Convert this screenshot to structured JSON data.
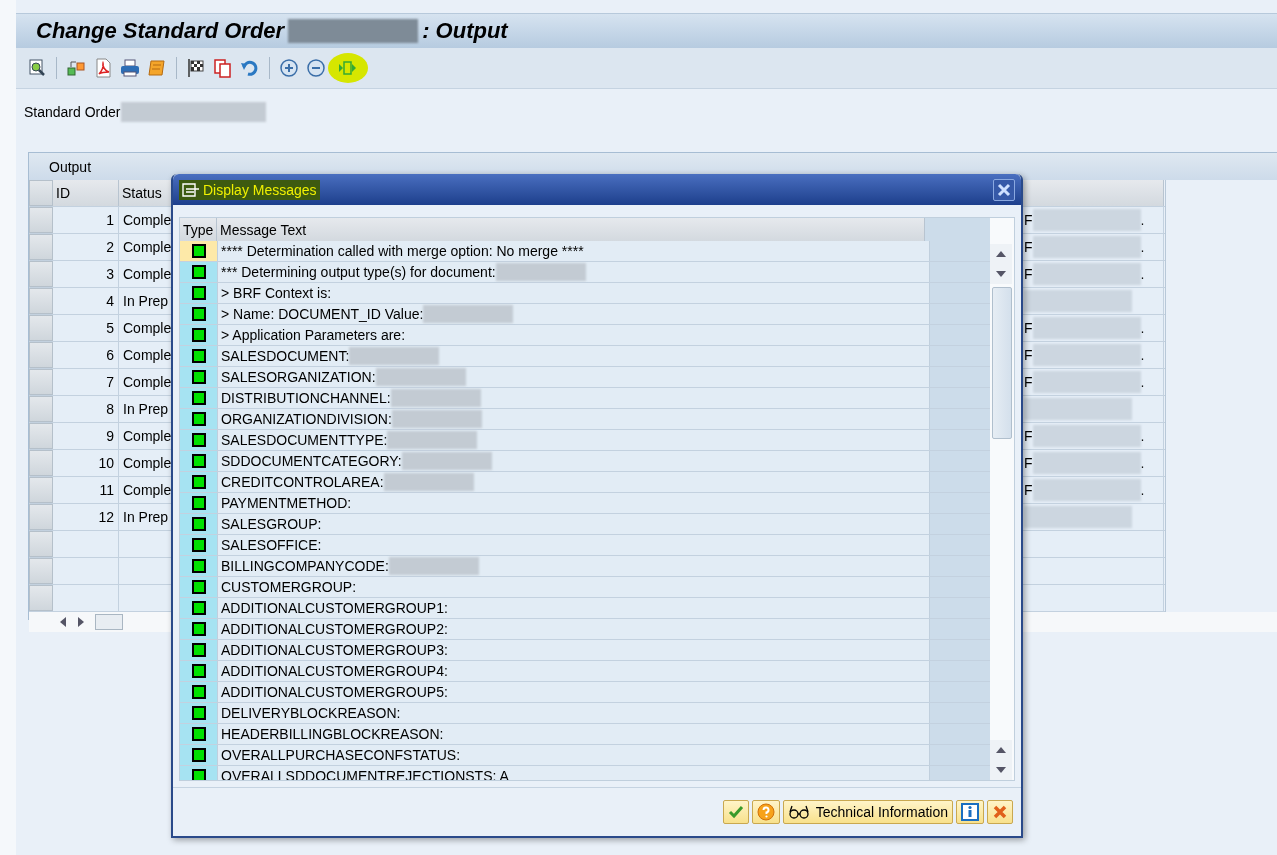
{
  "window": {
    "title_before": "Change Standard Order",
    "title_after": ": Output",
    "title_redacted": true
  },
  "toolbar": {
    "items": [
      {
        "kind": "display"
      },
      {
        "kind": "sep"
      },
      {
        "kind": "objects"
      },
      {
        "kind": "pdf"
      },
      {
        "kind": "print"
      },
      {
        "kind": "scroll"
      },
      {
        "kind": "sep"
      },
      {
        "kind": "flag"
      },
      {
        "kind": "copy"
      },
      {
        "kind": "undo"
      },
      {
        "kind": "sep"
      },
      {
        "kind": "plus"
      },
      {
        "kind": "minus"
      },
      {
        "kind": "process",
        "highlighted": true
      }
    ]
  },
  "header_field": {
    "label": "Standard Order",
    "redacted": true
  },
  "output": {
    "title": "Output",
    "columns": [
      "ID",
      "Status"
    ],
    "rows": [
      {
        "id": "1",
        "status": "Comple",
        "column_3": "F",
        "column_3_end": "."
      },
      {
        "id": "2",
        "status": "Comple",
        "column_3": "F",
        "column_3_end": "."
      },
      {
        "id": "3",
        "status": "Comple",
        "column_3": "F",
        "column_3_end": "."
      },
      {
        "id": "4",
        "status": "In Prep"
      },
      {
        "id": "5",
        "status": "Comple",
        "column_3": "F",
        "column_3_end": "."
      },
      {
        "id": "6",
        "status": "Comple",
        "column_3": "F",
        "column_3_end": "."
      },
      {
        "id": "7",
        "status": "Comple",
        "column_3": "F",
        "column_3_end": "."
      },
      {
        "id": "8",
        "status": "In Prep"
      },
      {
        "id": "9",
        "status": "Comple",
        "column_3": "F",
        "column_3_end": "."
      },
      {
        "id": "10",
        "status": "Comple",
        "column_3": "F",
        "column_3_end": "."
      },
      {
        "id": "11",
        "status": "Comple",
        "column_3": "F",
        "column_3_end": "."
      },
      {
        "id": "12",
        "status": "In Prep"
      }
    ]
  },
  "dialog": {
    "title": "Display Messages",
    "title_highlighted": true,
    "columns": [
      "Type",
      "Message Text"
    ],
    "messages": [
      {
        "selected": true,
        "text": "**** Determination called with merge option: No merge  ****"
      },
      {
        "selected": false,
        "text": "*** Determining output type(s) for document:",
        "redacted": true
      },
      {
        "selected": false,
        "text": "> BRF Context is:"
      },
      {
        "selected": false,
        "text": "> Name: DOCUMENT_ID Value:",
        "redacted": true
      },
      {
        "selected": false,
        "text": "> Application Parameters are:"
      },
      {
        "selected": false,
        "text": "SALESDOCUMENT:",
        "redacted": true
      },
      {
        "selected": false,
        "text": "SALESORGANIZATION:",
        "redacted": true
      },
      {
        "selected": false,
        "text": "DISTRIBUTIONCHANNEL:",
        "redacted": true
      },
      {
        "selected": false,
        "text": "ORGANIZATIONDIVISION:",
        "redacted": true
      },
      {
        "selected": false,
        "text": "SALESDOCUMENTTYPE:",
        "redacted": true
      },
      {
        "selected": false,
        "text": "SDDOCUMENTCATEGORY:",
        "redacted": true
      },
      {
        "selected": false,
        "text": "CREDITCONTROLAREA:",
        "redacted": true
      },
      {
        "selected": false,
        "text": "PAYMENTMETHOD:"
      },
      {
        "selected": false,
        "text": "SALESGROUP:"
      },
      {
        "selected": false,
        "text": "SALESOFFICE:"
      },
      {
        "selected": false,
        "text": "BILLINGCOMPANYCODE:",
        "redacted": true
      },
      {
        "selected": false,
        "text": "CUSTOMERGROUP:"
      },
      {
        "selected": false,
        "text": "ADDITIONALCUSTOMERGROUP1:"
      },
      {
        "selected": false,
        "text": "ADDITIONALCUSTOMERGROUP2:"
      },
      {
        "selected": false,
        "text": "ADDITIONALCUSTOMERGROUP3:"
      },
      {
        "selected": false,
        "text": "ADDITIONALCUSTOMERGROUP4:"
      },
      {
        "selected": false,
        "text": "ADDITIONALCUSTOMERGROUP5:"
      },
      {
        "selected": false,
        "text": "DELIVERYBLOCKREASON:"
      },
      {
        "selected": false,
        "text": "HEADERBILLINGBLOCKREASON:"
      },
      {
        "selected": false,
        "text": "OVERALLPURCHASECONFSTATUS:"
      },
      {
        "selected": false,
        "text": "OVERALLSDDOCUMENTREJECTIONSTS: A"
      }
    ],
    "buttons": [
      {
        "kind": "ok"
      },
      {
        "kind": "help"
      },
      {
        "kind": "technical",
        "label": "Technical Information"
      },
      {
        "kind": "info"
      },
      {
        "kind": "cancel"
      }
    ]
  }
}
